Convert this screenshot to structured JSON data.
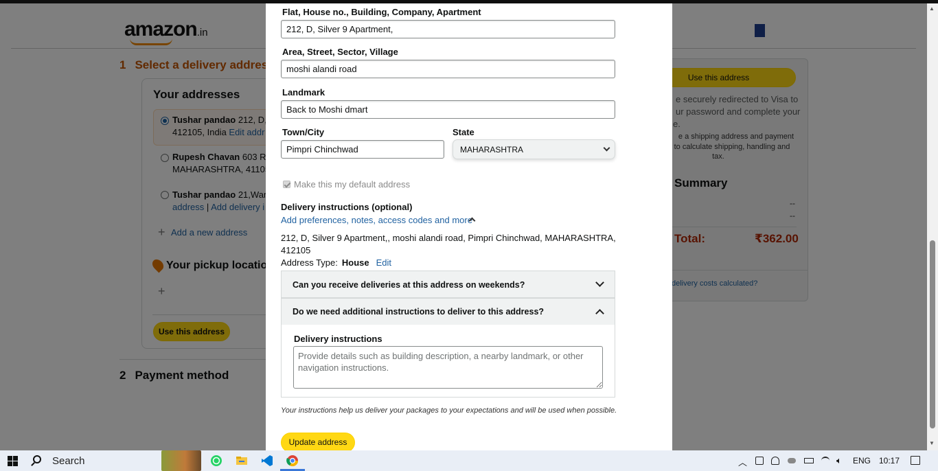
{
  "background": {
    "logo": {
      "text": "amazon",
      "suffix": ".in"
    },
    "step1": {
      "num": "1",
      "title": "Select a delivery address"
    },
    "addresses": {
      "heading": "Your addresses",
      "items": [
        {
          "name": "Tushar pandao",
          "line1": " 212, D,",
          "line2": "412105, India ",
          "link": "Edit addr",
          "selected": true
        },
        {
          "name": "Rupesh Chavan",
          "line1": " 603 Ro",
          "line2": "MAHARASHTRA, 41105",
          "selected": false
        },
        {
          "name": "Tushar pandao",
          "line1": " 21,Waru",
          "line2_link1": "address",
          "line2_sep": " | ",
          "line2_link2": "Add delivery i",
          "selected": false
        }
      ],
      "add_new": "Add a new address",
      "pickup_heading": "Your pickup locatio",
      "use_button": "Use this address"
    },
    "step2": {
      "num": "2",
      "title": "Payment method"
    },
    "summary": {
      "use_button": "Use this address",
      "redirect_lines": [
        "e securely redirected to Visa to",
        "ur password and complete your",
        "e."
      ],
      "shipping_lines": [
        "e a shipping address and payment",
        "to calculate shipping, handling and",
        "tax."
      ],
      "heading": "Summary",
      "dash1": "--",
      "dash2": "--",
      "total_label": "Total:",
      "total_value": "₹362.00",
      "link": "delivery costs calculated?"
    }
  },
  "modal": {
    "flat": {
      "label": "Flat, House no., Building, Company, Apartment",
      "value": "212, D, Silver 9 Apartment,"
    },
    "area": {
      "label": "Area, Street, Sector, Village",
      "value": "moshi alandi road"
    },
    "landmark": {
      "label": "Landmark",
      "value": "Back to Moshi dmart"
    },
    "town": {
      "label": "Town/City",
      "value": "Pimpri Chinchwad"
    },
    "state": {
      "label": "State",
      "value": "MAHARASHTRA"
    },
    "default_checkbox": {
      "label": "Make this my default address",
      "checked": true
    },
    "delivery_instructions": {
      "heading": "Delivery instructions (optional)",
      "link": "Add preferences, notes, access codes and more"
    },
    "address_summary": "212, D, Silver 9 Apartment,, moshi alandi road, Pimpri Chinchwad, MAHARASHTRA, 412105",
    "address_type": {
      "label": "Address Type:",
      "value": "House",
      "edit": "Edit"
    },
    "accordion": [
      {
        "title": "Can you receive deliveries at this address on weekends?",
        "expanded": false
      },
      {
        "title": "Do we need additional instructions to deliver to this address?",
        "expanded": true
      }
    ],
    "instructions_field": {
      "label": "Delivery instructions",
      "placeholder": "Provide details such as building description, a nearby landmark, or other navigation instructions."
    },
    "note": "Your instructions help us deliver your packages to your expectations and will be used when possible.",
    "update_button": "Update address"
  },
  "taskbar": {
    "search": "Search",
    "language": "ENG",
    "time": "10:17"
  },
  "colors": {
    "accent_yellow": "#ffd814",
    "link_blue": "#2162a1",
    "price_red": "#b12704",
    "step_orange": "#c45500"
  }
}
